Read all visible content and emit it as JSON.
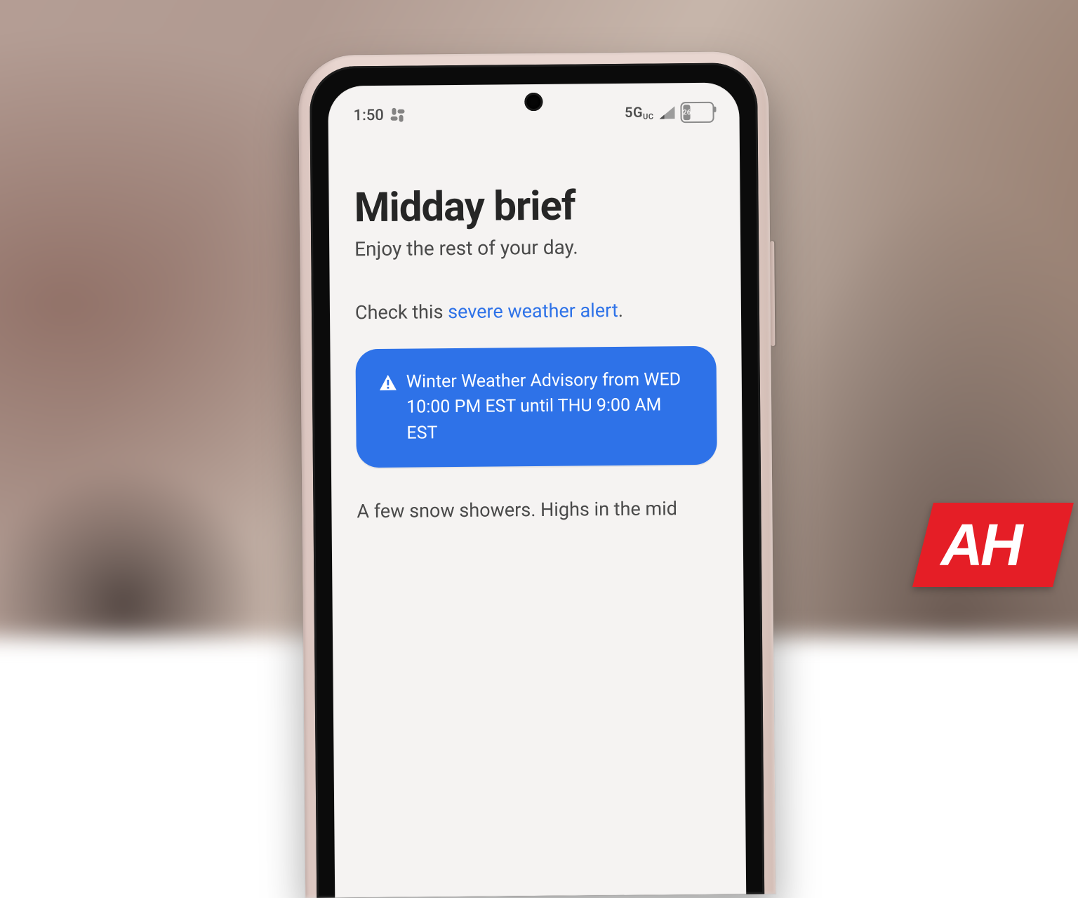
{
  "status_bar": {
    "time": "1:50",
    "network_label": "5G",
    "network_sub": "UC",
    "battery_level": "26",
    "battery_pct": 26
  },
  "brief": {
    "title": "Midday brief",
    "subtitle": "Enjoy the rest of your day."
  },
  "alert_line": {
    "prefix": "Check this ",
    "link_text": "severe weather alert",
    "suffix": "."
  },
  "advisory": {
    "text": "Winter Weather Advisory from WED 10:00 PM EST until THU 9:00 AM EST"
  },
  "forecast": {
    "text": "A few snow showers. Highs in the mid"
  },
  "watermark": {
    "text": "AH"
  }
}
